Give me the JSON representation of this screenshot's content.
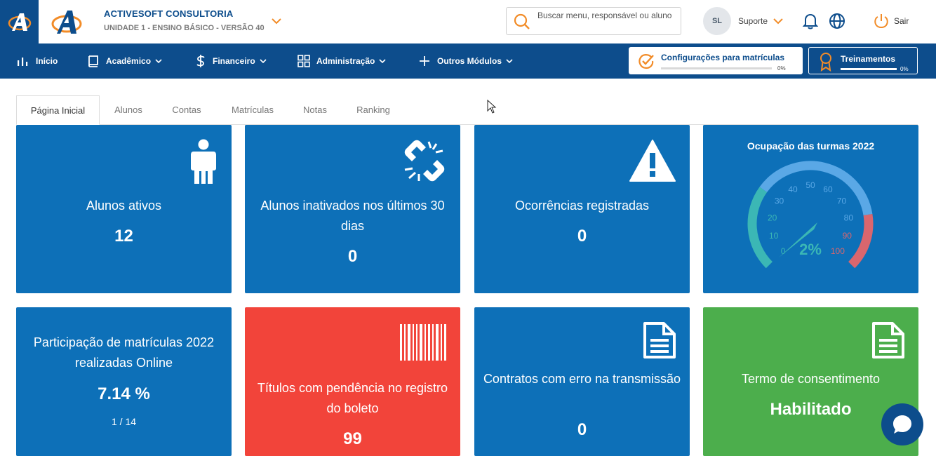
{
  "header": {
    "company_name": "ACTIVESOFT CONSULTORIA",
    "unit": "UNIDADE 1 - ENSINO BÁSICO - VERSÃO 40",
    "search_placeholder": "Buscar menu, responsável ou aluno",
    "avatar_initials": "SL",
    "support_label": "Suporte",
    "logout_label": "Sair"
  },
  "nav": {
    "items": [
      {
        "label": "Início"
      },
      {
        "label": "Acadêmico"
      },
      {
        "label": "Financeiro"
      },
      {
        "label": "Administração"
      },
      {
        "label": "Outros Módulos"
      }
    ],
    "config_label": "Configurações para matrículas",
    "config_percent": "0%",
    "config_progress": 0,
    "training_label": "Treinamentos",
    "training_percent": "0%",
    "training_progress": 0
  },
  "tabs": [
    "Página Inicial",
    "Alunos",
    "Contas",
    "Matrículas",
    "Notas",
    "Ranking"
  ],
  "cards": {
    "active_students": {
      "title": "Alunos ativos",
      "value": "12"
    },
    "inactivated_students": {
      "title": "Alunos inativados nos últimos 30 dias",
      "value": "0"
    },
    "occurrences": {
      "title": "Ocorrências registradas",
      "value": "0"
    },
    "occupancy": {
      "title": "Ocupação das turmas 2022",
      "value": "2%",
      "value_num": 2,
      "ticks": [
        "0",
        "10",
        "20",
        "30",
        "40",
        "50",
        "60",
        "70",
        "80",
        "90",
        "100"
      ]
    },
    "online_enrollment": {
      "title": "Participação de matrículas 2022 realizadas Online",
      "value": "7.14 %",
      "detail": "1 / 14"
    },
    "boleto_pending": {
      "title": "Títulos com pendência no registro do boleto",
      "value": "99"
    },
    "contract_errors": {
      "title": "Contratos com erro na transmissão",
      "value": "0"
    },
    "consent": {
      "title": "Termo de consentimento",
      "value": "Habilitado"
    }
  },
  "colors": {
    "brand": "#0d4d8c",
    "card_blue": "#0d70b8",
    "card_red": "#f2443a",
    "card_green": "#4cae4c",
    "accent_orange": "#f28c28"
  }
}
